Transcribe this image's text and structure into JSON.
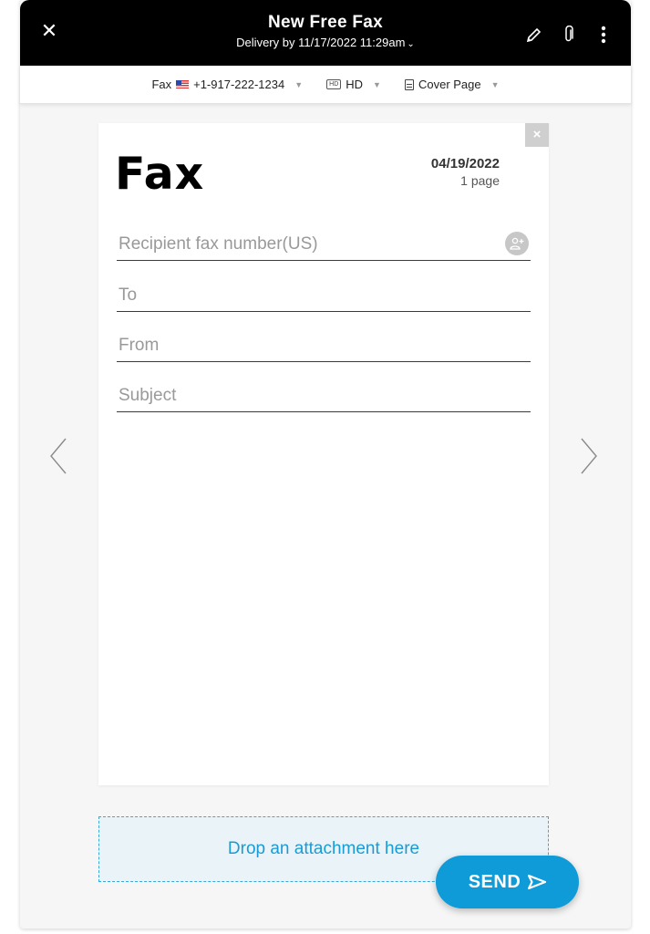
{
  "header": {
    "title": "New Free Fax",
    "delivery": "Delivery by 11/17/2022 11:29am",
    "close_icon": "✕",
    "icons": [
      "close-icon",
      "pencil-icon",
      "paperclip-icon",
      "more-vertical-icon"
    ]
  },
  "toolbar": {
    "fax_label": "Fax",
    "fax_number": "+1-917-222-1234",
    "quality": "HD",
    "cover_page": "Cover Page"
  },
  "cover": {
    "heading": "Fax",
    "date": "04/19/2022",
    "pages": "1 page",
    "close": "×"
  },
  "fields": {
    "recipient_placeholder": "Recipient fax number(US)",
    "to_placeholder": "To",
    "from_placeholder": "From",
    "subject_placeholder": "Subject"
  },
  "drop_zone": {
    "label": "Drop an attachment here"
  },
  "send": {
    "label": "SEND"
  },
  "colors": {
    "accent": "#0f9ad8",
    "header_bg": "#000000",
    "drop_border": "#3aa9d9",
    "drop_bg": "#eaf3f8"
  }
}
